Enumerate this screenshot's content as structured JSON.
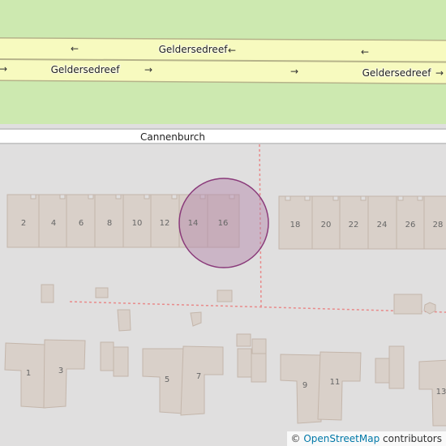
{
  "map": {
    "colors": {
      "park": "#cde9b0",
      "land": "#e0dfdf",
      "road_fill": "#f7fabf",
      "road_casing": "#b6b38a",
      "service_road": "#ffffff",
      "building_fill": "#d9d0c9",
      "building_stroke": "#c4b6ab",
      "boundary": "#e88a8a",
      "marker_fill": "#b283a9",
      "marker_stroke": "#8a3a7a"
    },
    "streets": {
      "main_label_top": "Geldersedreef",
      "main_label_bottom_left": "Geldersedreef",
      "main_label_bottom_right": "Geldersedreef",
      "side_street": "Cannenburch"
    },
    "arrows": {
      "left": "←",
      "right": "→"
    },
    "house_numbers_top_row": [
      "2",
      "4",
      "6",
      "8",
      "10",
      "12",
      "14",
      "16",
      "18",
      "20",
      "22",
      "24",
      "26",
      "28"
    ],
    "house_numbers_bottom_row": [
      "1",
      "3",
      "5",
      "7",
      "9",
      "11",
      "13"
    ],
    "highlighted_house": "16"
  },
  "attribution": {
    "prefix": "©",
    "link": "OpenStreetMap",
    "suffix": "contributors"
  }
}
